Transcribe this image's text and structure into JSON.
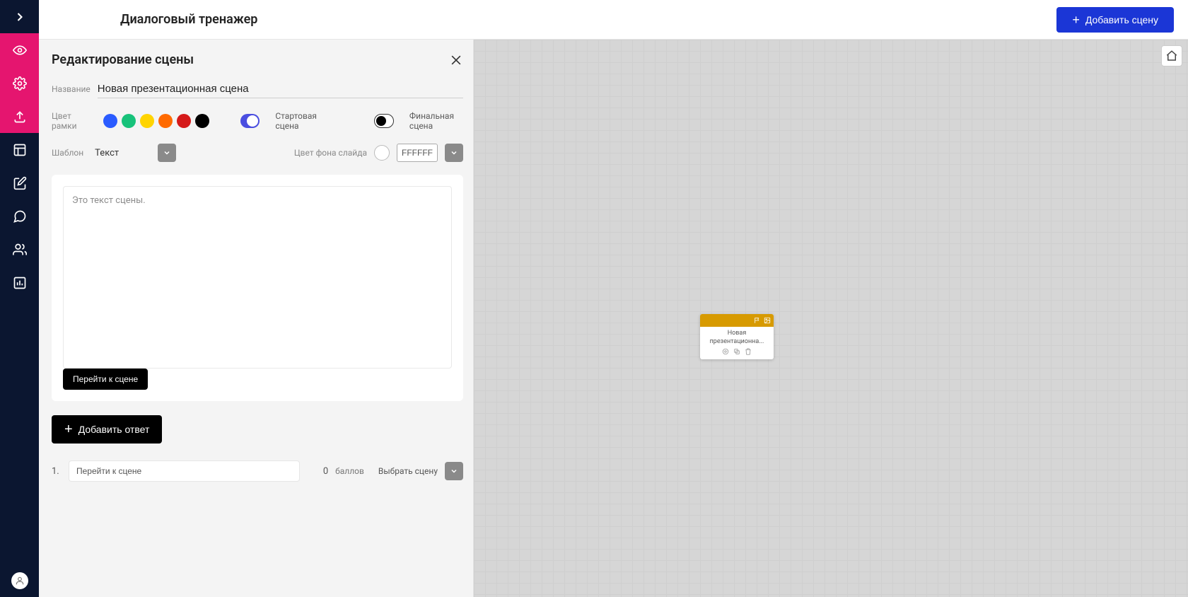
{
  "header": {
    "title": "Диалоговый тренажер",
    "add_scene_label": "Добавить сцену"
  },
  "editor": {
    "heading": "Редактирование сцены",
    "name_label": "Название",
    "name_value": "Новая презентационная сцена",
    "frame_color_label": "Цвет рамки",
    "frame_colors": [
      "#2a5bff",
      "#17c27a",
      "#ffd400",
      "#ff6a00",
      "#d51a1a",
      "#000000"
    ],
    "start_scene_label": "Стартовая сцена",
    "start_scene_on": true,
    "final_scene_label": "Финальная сцена",
    "final_scene_on": false,
    "template_label": "Шаблон",
    "template_value": "Текст",
    "bg_color_label": "Цвет фона слайда",
    "bg_color_hex": "FFFFFF",
    "scene_text_placeholder": "Это текст сцены.",
    "goto_scene_label": "Перейти к сцене",
    "add_answer_label": "Добавить ответ",
    "answers": [
      {
        "index": "1.",
        "text": "Перейти к сцене",
        "points": "0",
        "points_label": "баллов",
        "select_scene_label": "Выбрать сцену"
      }
    ]
  },
  "canvas": {
    "scene_card_title": "Новая презентационна..."
  }
}
